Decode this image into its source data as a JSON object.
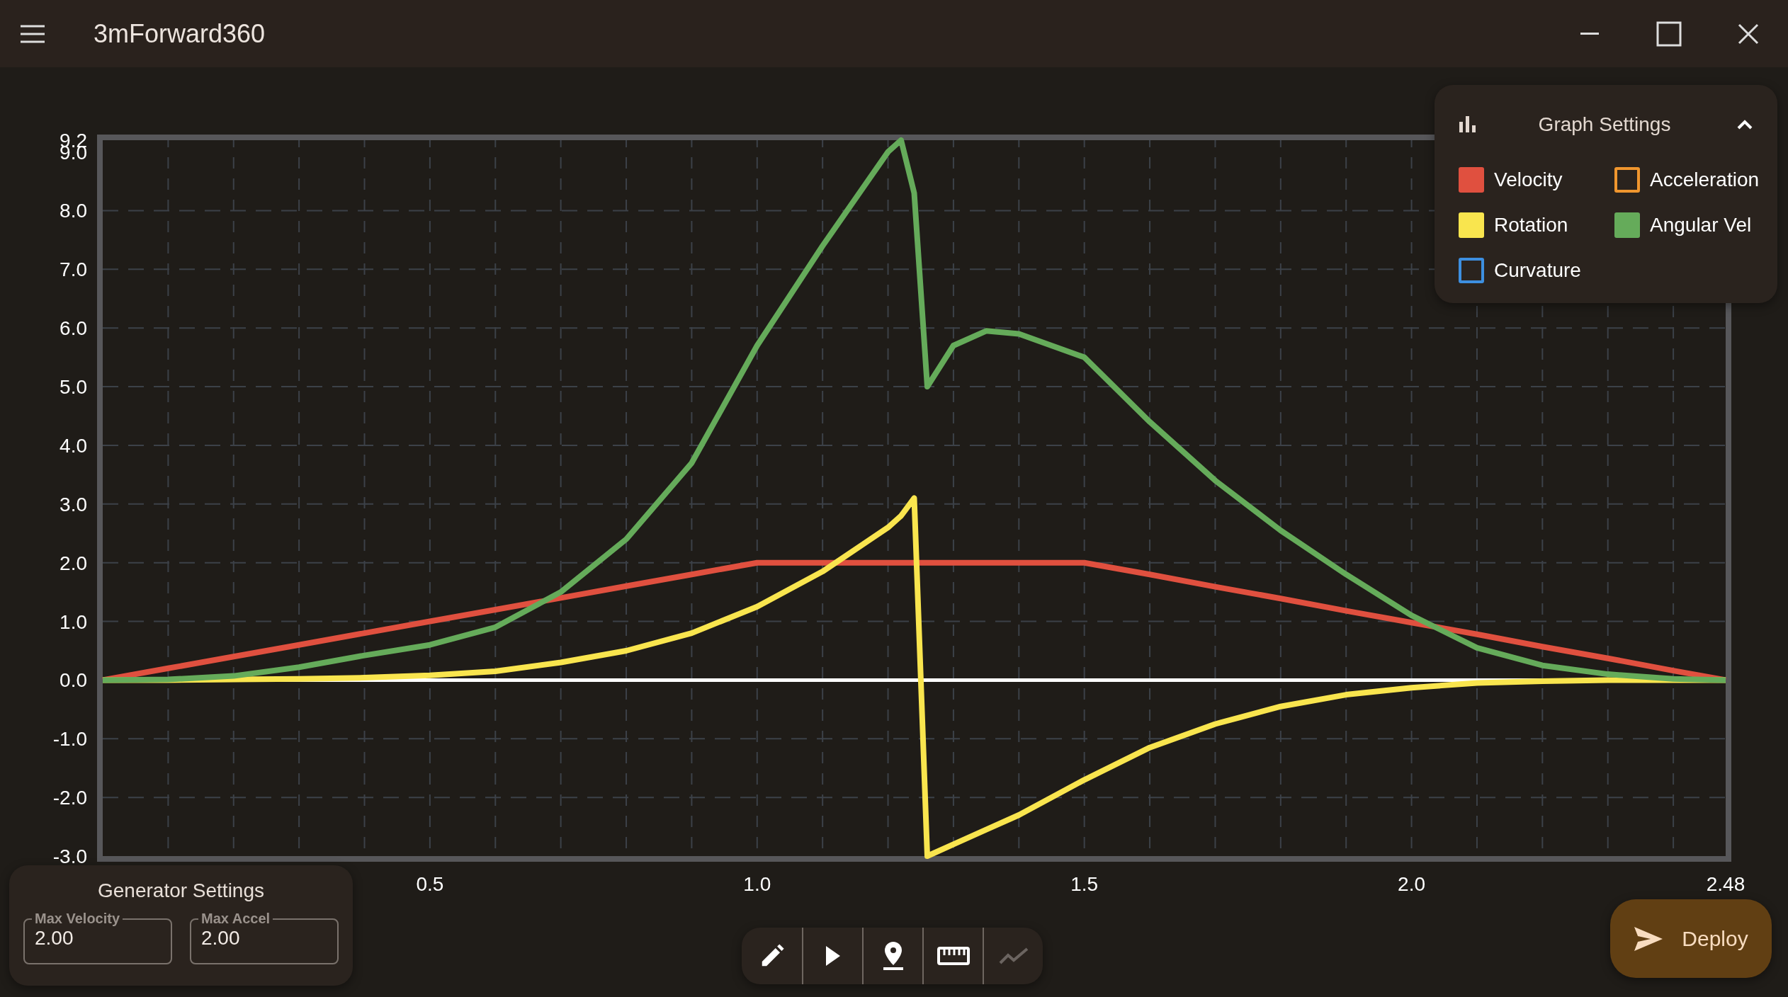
{
  "window": {
    "title": "3mForward360"
  },
  "graph": {
    "chart_data": {
      "type": "line",
      "grid": true,
      "x": [
        0,
        0.1,
        0.2,
        0.3,
        0.4,
        0.5,
        0.6,
        0.7,
        0.8,
        0.9,
        1.0,
        1.1,
        1.2,
        1.22,
        1.24,
        1.26,
        1.3,
        1.35,
        1.4,
        1.5,
        1.6,
        1.7,
        1.8,
        1.9,
        2.0,
        2.1,
        2.2,
        2.3,
        2.4,
        2.48
      ],
      "series": [
        {
          "color": "#e0503f",
          "values": [
            0,
            0.2,
            0.4,
            0.6,
            0.8,
            1.0,
            1.2,
            1.4,
            1.6,
            1.8,
            2.0,
            2.0,
            2.0,
            2.0,
            2.0,
            2.0,
            2.0,
            2.0,
            2.0,
            2.0,
            1.8,
            1.59,
            1.39,
            1.18,
            0.98,
            0.78,
            0.57,
            0.37,
            0.16,
            0
          ]
        },
        {
          "color": "#f9e54e",
          "values": [
            0,
            0,
            0.01,
            0.02,
            0.04,
            0.08,
            0.15,
            0.3,
            0.5,
            0.8,
            1.25,
            1.85,
            2.6,
            2.8,
            3.1,
            -3.0,
            -2.8,
            -2.55,
            -2.3,
            -1.7,
            -1.15,
            -0.75,
            -0.45,
            -0.25,
            -0.13,
            -0.05,
            -0.02,
            0,
            0,
            0
          ]
        },
        {
          "color": "#65ab5a",
          "values": [
            0,
            0.01,
            0.07,
            0.22,
            0.42,
            0.6,
            0.9,
            1.5,
            2.4,
            3.7,
            5.7,
            7.4,
            9.0,
            9.2,
            8.3,
            5.0,
            5.7,
            5.95,
            5.9,
            5.5,
            4.4,
            3.4,
            2.55,
            1.8,
            1.1,
            0.55,
            0.25,
            0.1,
            0.02,
            0
          ]
        }
      ],
      "xlim": [
        0,
        2.48
      ],
      "ylim": [
        -3,
        9.2
      ],
      "xticks": [
        {
          "value": 0.5,
          "label": "0.5"
        },
        {
          "value": 1,
          "label": "1.0"
        },
        {
          "value": 1.5,
          "label": "1.5"
        },
        {
          "value": 2,
          "label": "2.0"
        },
        {
          "value": 2.48,
          "label": "2.48"
        }
      ],
      "yticks": [
        {
          "value": 9.2,
          "label": "9.2"
        },
        {
          "value": 9,
          "label": "9.0"
        },
        {
          "value": 8,
          "label": "8.0"
        },
        {
          "value": 7,
          "label": "7.0"
        },
        {
          "value": 6,
          "label": "6.0"
        },
        {
          "value": 5,
          "label": "5.0"
        },
        {
          "value": 4,
          "label": "4.0"
        },
        {
          "value": 3,
          "label": "3.0"
        },
        {
          "value": 2,
          "label": "2.0"
        },
        {
          "value": 1,
          "label": "1.0"
        },
        {
          "value": 0,
          "label": "0.0"
        },
        {
          "value": -1,
          "label": "-1.0"
        },
        {
          "value": -2,
          "label": "-2.0"
        },
        {
          "value": -3,
          "label": "-3.0"
        }
      ]
    }
  },
  "graph_settings": {
    "title": "Graph Settings",
    "expanded": true,
    "items": [
      {
        "label": "Velocity",
        "color": "#e0503f",
        "checked": true
      },
      {
        "label": "Acceleration",
        "color": "#f0962e",
        "checked": false
      },
      {
        "label": "Rotation",
        "color": "#f9e54e",
        "checked": true
      },
      {
        "label": "Angular Vel",
        "color": "#65ab5a",
        "checked": true
      },
      {
        "label": "Curvature",
        "color": "#3d8fe0",
        "checked": false
      }
    ]
  },
  "generator_settings": {
    "title": "Generator Settings",
    "fields": [
      {
        "label": "Max Velocity",
        "value": "2.00"
      },
      {
        "label": "Max Accel",
        "value": "2.00"
      }
    ]
  },
  "toolbar": [
    {
      "disabled": false
    },
    {
      "disabled": false
    },
    {
      "disabled": false
    },
    {
      "disabled": false
    },
    {
      "disabled": true
    }
  ],
  "deploy_button": {
    "label": "Deploy"
  }
}
